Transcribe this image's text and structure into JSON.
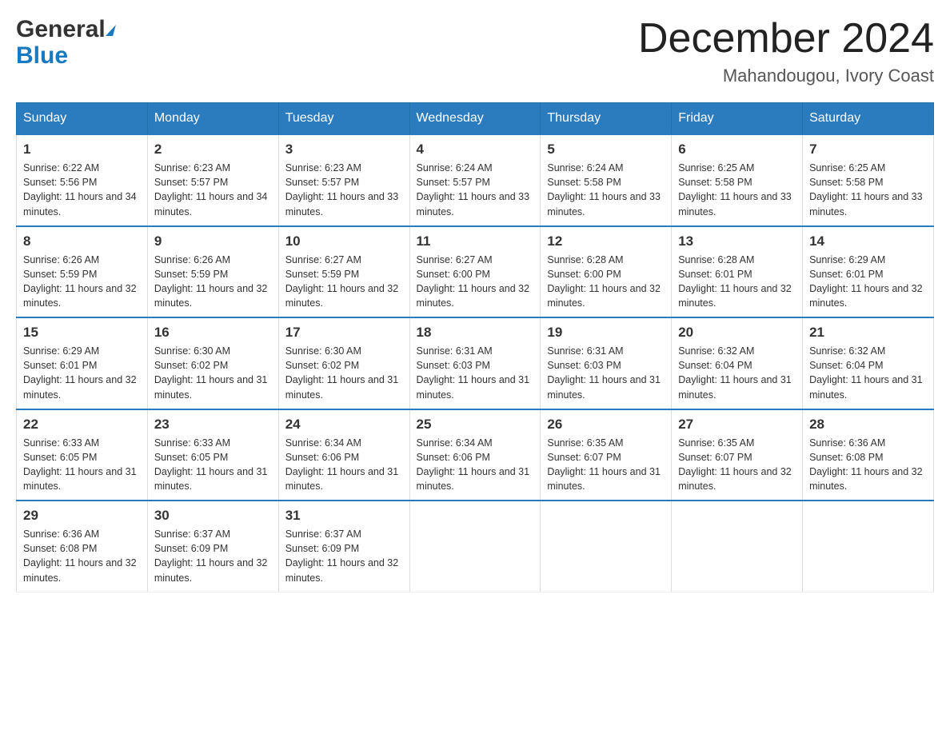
{
  "logo": {
    "general": "General",
    "blue": "Blue"
  },
  "title": "December 2024",
  "location": "Mahandougou, Ivory Coast",
  "headers": [
    "Sunday",
    "Monday",
    "Tuesday",
    "Wednesday",
    "Thursday",
    "Friday",
    "Saturday"
  ],
  "weeks": [
    [
      {
        "day": "1",
        "sunrise": "6:22 AM",
        "sunset": "5:56 PM",
        "daylight": "11 hours and 34 minutes."
      },
      {
        "day": "2",
        "sunrise": "6:23 AM",
        "sunset": "5:57 PM",
        "daylight": "11 hours and 34 minutes."
      },
      {
        "day": "3",
        "sunrise": "6:23 AM",
        "sunset": "5:57 PM",
        "daylight": "11 hours and 33 minutes."
      },
      {
        "day": "4",
        "sunrise": "6:24 AM",
        "sunset": "5:57 PM",
        "daylight": "11 hours and 33 minutes."
      },
      {
        "day": "5",
        "sunrise": "6:24 AM",
        "sunset": "5:58 PM",
        "daylight": "11 hours and 33 minutes."
      },
      {
        "day": "6",
        "sunrise": "6:25 AM",
        "sunset": "5:58 PM",
        "daylight": "11 hours and 33 minutes."
      },
      {
        "day": "7",
        "sunrise": "6:25 AM",
        "sunset": "5:58 PM",
        "daylight": "11 hours and 33 minutes."
      }
    ],
    [
      {
        "day": "8",
        "sunrise": "6:26 AM",
        "sunset": "5:59 PM",
        "daylight": "11 hours and 32 minutes."
      },
      {
        "day": "9",
        "sunrise": "6:26 AM",
        "sunset": "5:59 PM",
        "daylight": "11 hours and 32 minutes."
      },
      {
        "day": "10",
        "sunrise": "6:27 AM",
        "sunset": "5:59 PM",
        "daylight": "11 hours and 32 minutes."
      },
      {
        "day": "11",
        "sunrise": "6:27 AM",
        "sunset": "6:00 PM",
        "daylight": "11 hours and 32 minutes."
      },
      {
        "day": "12",
        "sunrise": "6:28 AM",
        "sunset": "6:00 PM",
        "daylight": "11 hours and 32 minutes."
      },
      {
        "day": "13",
        "sunrise": "6:28 AM",
        "sunset": "6:01 PM",
        "daylight": "11 hours and 32 minutes."
      },
      {
        "day": "14",
        "sunrise": "6:29 AM",
        "sunset": "6:01 PM",
        "daylight": "11 hours and 32 minutes."
      }
    ],
    [
      {
        "day": "15",
        "sunrise": "6:29 AM",
        "sunset": "6:01 PM",
        "daylight": "11 hours and 32 minutes."
      },
      {
        "day": "16",
        "sunrise": "6:30 AM",
        "sunset": "6:02 PM",
        "daylight": "11 hours and 31 minutes."
      },
      {
        "day": "17",
        "sunrise": "6:30 AM",
        "sunset": "6:02 PM",
        "daylight": "11 hours and 31 minutes."
      },
      {
        "day": "18",
        "sunrise": "6:31 AM",
        "sunset": "6:03 PM",
        "daylight": "11 hours and 31 minutes."
      },
      {
        "day": "19",
        "sunrise": "6:31 AM",
        "sunset": "6:03 PM",
        "daylight": "11 hours and 31 minutes."
      },
      {
        "day": "20",
        "sunrise": "6:32 AM",
        "sunset": "6:04 PM",
        "daylight": "11 hours and 31 minutes."
      },
      {
        "day": "21",
        "sunrise": "6:32 AM",
        "sunset": "6:04 PM",
        "daylight": "11 hours and 31 minutes."
      }
    ],
    [
      {
        "day": "22",
        "sunrise": "6:33 AM",
        "sunset": "6:05 PM",
        "daylight": "11 hours and 31 minutes."
      },
      {
        "day": "23",
        "sunrise": "6:33 AM",
        "sunset": "6:05 PM",
        "daylight": "11 hours and 31 minutes."
      },
      {
        "day": "24",
        "sunrise": "6:34 AM",
        "sunset": "6:06 PM",
        "daylight": "11 hours and 31 minutes."
      },
      {
        "day": "25",
        "sunrise": "6:34 AM",
        "sunset": "6:06 PM",
        "daylight": "11 hours and 31 minutes."
      },
      {
        "day": "26",
        "sunrise": "6:35 AM",
        "sunset": "6:07 PM",
        "daylight": "11 hours and 31 minutes."
      },
      {
        "day": "27",
        "sunrise": "6:35 AM",
        "sunset": "6:07 PM",
        "daylight": "11 hours and 32 minutes."
      },
      {
        "day": "28",
        "sunrise": "6:36 AM",
        "sunset": "6:08 PM",
        "daylight": "11 hours and 32 minutes."
      }
    ],
    [
      {
        "day": "29",
        "sunrise": "6:36 AM",
        "sunset": "6:08 PM",
        "daylight": "11 hours and 32 minutes."
      },
      {
        "day": "30",
        "sunrise": "6:37 AM",
        "sunset": "6:09 PM",
        "daylight": "11 hours and 32 minutes."
      },
      {
        "day": "31",
        "sunrise": "6:37 AM",
        "sunset": "6:09 PM",
        "daylight": "11 hours and 32 minutes."
      },
      null,
      null,
      null,
      null
    ]
  ]
}
